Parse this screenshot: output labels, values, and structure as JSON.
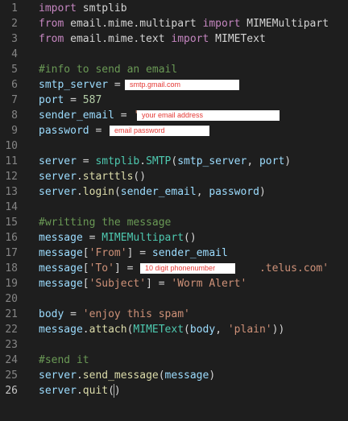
{
  "editor": {
    "active_line": "26",
    "lines": [
      {
        "n": "1",
        "tokens": [
          {
            "t": "import",
            "c": "kw"
          },
          {
            "t": " smtplib",
            "c": "pn"
          }
        ]
      },
      {
        "n": "2",
        "tokens": [
          {
            "t": "from",
            "c": "kw"
          },
          {
            "t": " email.mime.multipart ",
            "c": "pn"
          },
          {
            "t": "import",
            "c": "kw"
          },
          {
            "t": " MIMEMultipart",
            "c": "pn"
          }
        ]
      },
      {
        "n": "3",
        "tokens": [
          {
            "t": "from",
            "c": "kw"
          },
          {
            "t": " email.mime.text ",
            "c": "pn"
          },
          {
            "t": "import",
            "c": "kw"
          },
          {
            "t": " MIMEText",
            "c": "pn"
          }
        ]
      },
      {
        "n": "4",
        "tokens": []
      },
      {
        "n": "5",
        "tokens": [
          {
            "t": "#info to send an email",
            "c": "cmt"
          }
        ]
      },
      {
        "n": "6",
        "tokens": [
          {
            "t": "smtp_server",
            "c": "var"
          },
          {
            "t": " = ",
            "c": "pn"
          }
        ]
      },
      {
        "n": "7",
        "tokens": [
          {
            "t": "port",
            "c": "var"
          },
          {
            "t": " = ",
            "c": "pn"
          },
          {
            "t": "587",
            "c": "num"
          }
        ]
      },
      {
        "n": "8",
        "tokens": [
          {
            "t": "sender_email",
            "c": "var"
          },
          {
            "t": " = ",
            "c": "pn"
          },
          {
            "t": "'",
            "c": "str"
          }
        ]
      },
      {
        "n": "9",
        "tokens": [
          {
            "t": "password",
            "c": "var"
          },
          {
            "t": " = ",
            "c": "pn"
          }
        ]
      },
      {
        "n": "10",
        "tokens": []
      },
      {
        "n": "11",
        "tokens": [
          {
            "t": "server",
            "c": "var"
          },
          {
            "t": " = ",
            "c": "pn"
          },
          {
            "t": "smtplib",
            "c": "cls"
          },
          {
            "t": ".",
            "c": "pn"
          },
          {
            "t": "SMTP",
            "c": "cls"
          },
          {
            "t": "(",
            "c": "pn"
          },
          {
            "t": "smtp_server",
            "c": "var"
          },
          {
            "t": ", ",
            "c": "pn"
          },
          {
            "t": "port",
            "c": "var"
          },
          {
            "t": ")",
            "c": "pn"
          }
        ]
      },
      {
        "n": "12",
        "tokens": [
          {
            "t": "server",
            "c": "var"
          },
          {
            "t": ".",
            "c": "pn"
          },
          {
            "t": "starttls",
            "c": "fn"
          },
          {
            "t": "()",
            "c": "pn"
          }
        ]
      },
      {
        "n": "13",
        "tokens": [
          {
            "t": "server",
            "c": "var"
          },
          {
            "t": ".",
            "c": "pn"
          },
          {
            "t": "login",
            "c": "fn"
          },
          {
            "t": "(",
            "c": "pn"
          },
          {
            "t": "sender_email",
            "c": "var"
          },
          {
            "t": ", ",
            "c": "pn"
          },
          {
            "t": "password",
            "c": "var"
          },
          {
            "t": ")",
            "c": "pn"
          }
        ]
      },
      {
        "n": "14",
        "tokens": []
      },
      {
        "n": "15",
        "tokens": [
          {
            "t": "#writting the message",
            "c": "cmt"
          }
        ]
      },
      {
        "n": "16",
        "tokens": [
          {
            "t": "message",
            "c": "var"
          },
          {
            "t": " = ",
            "c": "pn"
          },
          {
            "t": "MIMEMultipart",
            "c": "cls"
          },
          {
            "t": "()",
            "c": "pn"
          }
        ]
      },
      {
        "n": "17",
        "tokens": [
          {
            "t": "message",
            "c": "var"
          },
          {
            "t": "[",
            "c": "pn"
          },
          {
            "t": "'From'",
            "c": "str"
          },
          {
            "t": "] = ",
            "c": "pn"
          },
          {
            "t": "sender_email",
            "c": "var"
          }
        ]
      },
      {
        "n": "18",
        "tokens": [
          {
            "t": "message",
            "c": "var"
          },
          {
            "t": "[",
            "c": "pn"
          },
          {
            "t": "'To'",
            "c": "str"
          },
          {
            "t": "] = ",
            "c": "pn"
          },
          {
            "t": "'",
            "c": "str"
          },
          {
            "t": "                  ",
            "c": "pn"
          },
          {
            "t": ".telus.com'",
            "c": "str"
          }
        ]
      },
      {
        "n": "19",
        "tokens": [
          {
            "t": "message",
            "c": "var"
          },
          {
            "t": "[",
            "c": "pn"
          },
          {
            "t": "'Subject'",
            "c": "str"
          },
          {
            "t": "] = ",
            "c": "pn"
          },
          {
            "t": "'Worm Alert'",
            "c": "str"
          }
        ]
      },
      {
        "n": "20",
        "tokens": []
      },
      {
        "n": "21",
        "tokens": [
          {
            "t": "body",
            "c": "var"
          },
          {
            "t": " = ",
            "c": "pn"
          },
          {
            "t": "'enjoy this spam'",
            "c": "str"
          }
        ]
      },
      {
        "n": "22",
        "tokens": [
          {
            "t": "message",
            "c": "var"
          },
          {
            "t": ".",
            "c": "pn"
          },
          {
            "t": "attach",
            "c": "fn"
          },
          {
            "t": "(",
            "c": "pn"
          },
          {
            "t": "MIMEText",
            "c": "cls"
          },
          {
            "t": "(",
            "c": "pn"
          },
          {
            "t": "body",
            "c": "var"
          },
          {
            "t": ", ",
            "c": "pn"
          },
          {
            "t": "'plain'",
            "c": "str"
          },
          {
            "t": "))",
            "c": "pn"
          }
        ]
      },
      {
        "n": "23",
        "tokens": []
      },
      {
        "n": "24",
        "tokens": [
          {
            "t": "#send it",
            "c": "cmt"
          }
        ]
      },
      {
        "n": "25",
        "tokens": [
          {
            "t": "server",
            "c": "var"
          },
          {
            "t": ".",
            "c": "pn"
          },
          {
            "t": "send_message",
            "c": "fn"
          },
          {
            "t": "(",
            "c": "pn"
          },
          {
            "t": "message",
            "c": "var"
          },
          {
            "t": ")",
            "c": "pn"
          }
        ]
      },
      {
        "n": "26",
        "tokens": [
          {
            "t": "server",
            "c": "var"
          },
          {
            "t": ".",
            "c": "pn"
          },
          {
            "t": "quit",
            "c": "fn"
          },
          {
            "t": "()",
            "c": "pn"
          }
        ]
      }
    ],
    "redactions": {
      "smtp": "smtp.gmail.com",
      "sender": "your email address",
      "password": "email password",
      "phone": "10 digit phonenumber"
    }
  }
}
